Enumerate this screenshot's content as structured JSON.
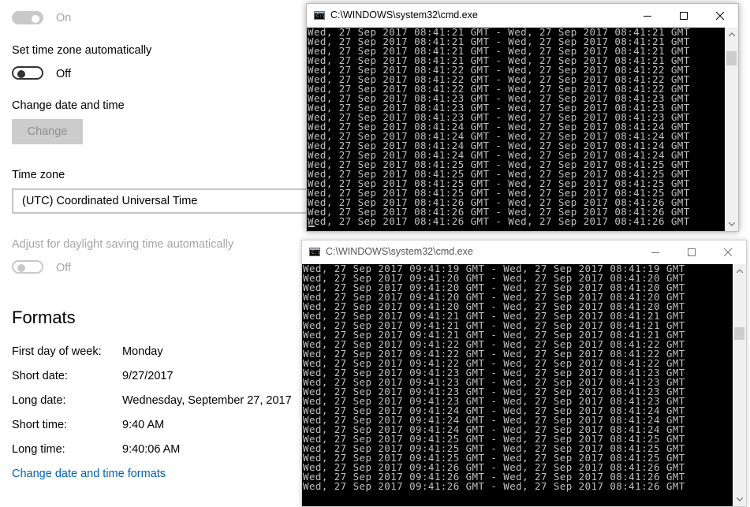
{
  "settings": {
    "top_toggle_state": "On",
    "set_tz_auto_label": "Set time zone automatically",
    "set_tz_auto_state": "Off",
    "change_dt_label": "Change date and time",
    "change_button": "Change",
    "time_zone_label": "Time zone",
    "time_zone_value": "(UTC) Coordinated Universal Time",
    "dst_label": "Adjust for daylight saving time automatically",
    "dst_state": "Off",
    "formats_heading": "Formats",
    "formats": [
      {
        "label": "First day of week:",
        "value": "Monday"
      },
      {
        "label": "Short date:",
        "value": "9/27/2017"
      },
      {
        "label": "Long date:",
        "value": "Wednesday, September 27, 2017"
      },
      {
        "label": "Short time:",
        "value": "9:40 AM"
      },
      {
        "label": "Long time:",
        "value": "9:40:06 AM"
      }
    ],
    "change_formats_link": "Change date and time formats"
  },
  "cmd_top": {
    "title": "C:\\WINDOWS\\system32\\cmd.exe",
    "icon_text": "C:\\",
    "lines": [
      "Wed, 27 Sep 2017 08:41:21 GMT - Wed, 27 Sep 2017 08:41:21 GMT",
      "Wed, 27 Sep 2017 08:41:21 GMT - Wed, 27 Sep 2017 08:41:21 GMT",
      "Wed, 27 Sep 2017 08:41:21 GMT - Wed, 27 Sep 2017 08:41:21 GMT",
      "Wed, 27 Sep 2017 08:41:21 GMT - Wed, 27 Sep 2017 08:41:21 GMT",
      "Wed, 27 Sep 2017 08:41:22 GMT - Wed, 27 Sep 2017 08:41:22 GMT",
      "Wed, 27 Sep 2017 08:41:22 GMT - Wed, 27 Sep 2017 08:41:22 GMT",
      "Wed, 27 Sep 2017 08:41:22 GMT - Wed, 27 Sep 2017 08:41:22 GMT",
      "Wed, 27 Sep 2017 08:41:23 GMT - Wed, 27 Sep 2017 08:41:23 GMT",
      "Wed, 27 Sep 2017 08:41:23 GMT - Wed, 27 Sep 2017 08:41:23 GMT",
      "Wed, 27 Sep 2017 08:41:23 GMT - Wed, 27 Sep 2017 08:41:23 GMT",
      "Wed, 27 Sep 2017 08:41:24 GMT - Wed, 27 Sep 2017 08:41:24 GMT",
      "Wed, 27 Sep 2017 08:41:24 GMT - Wed, 27 Sep 2017 08:41:24 GMT",
      "Wed, 27 Sep 2017 08:41:24 GMT - Wed, 27 Sep 2017 08:41:24 GMT",
      "Wed, 27 Sep 2017 08:41:24 GMT - Wed, 27 Sep 2017 08:41:24 GMT",
      "Wed, 27 Sep 2017 08:41:25 GMT - Wed, 27 Sep 2017 08:41:25 GMT",
      "Wed, 27 Sep 2017 08:41:25 GMT - Wed, 27 Sep 2017 08:41:25 GMT",
      "Wed, 27 Sep 2017 08:41:25 GMT - Wed, 27 Sep 2017 08:41:25 GMT",
      "Wed, 27 Sep 2017 08:41:25 GMT - Wed, 27 Sep 2017 08:41:25 GMT",
      "Wed, 27 Sep 2017 08:41:26 GMT - Wed, 27 Sep 2017 08:41:26 GMT",
      "Wed, 27 Sep 2017 08:41:26 GMT - Wed, 27 Sep 2017 08:41:26 GMT",
      "Wed, 27 Sep 2017 08:41:26 GMT - Wed, 27 Sep 2017 08:41:26 GMT"
    ]
  },
  "cmd_bottom": {
    "title": "C:\\WINDOWS\\system32\\cmd.exe",
    "icon_text": "C:\\",
    "lines": [
      "Wed, 27 Sep 2017 09:41:19 GMT - Wed, 27 Sep 2017 08:41:19 GMT",
      "Wed, 27 Sep 2017 09:41:20 GMT - Wed, 27 Sep 2017 08:41:20 GMT",
      "Wed, 27 Sep 2017 09:41:20 GMT - Wed, 27 Sep 2017 08:41:20 GMT",
      "Wed, 27 Sep 2017 09:41:20 GMT - Wed, 27 Sep 2017 08:41:20 GMT",
      "Wed, 27 Sep 2017 09:41:20 GMT - Wed, 27 Sep 2017 08:41:20 GMT",
      "Wed, 27 Sep 2017 09:41:21 GMT - Wed, 27 Sep 2017 08:41:21 GMT",
      "Wed, 27 Sep 2017 09:41:21 GMT - Wed, 27 Sep 2017 08:41:21 GMT",
      "Wed, 27 Sep 2017 09:41:21 GMT - Wed, 27 Sep 2017 08:41:21 GMT",
      "Wed, 27 Sep 2017 09:41:22 GMT - Wed, 27 Sep 2017 08:41:22 GMT",
      "Wed, 27 Sep 2017 09:41:22 GMT - Wed, 27 Sep 2017 08:41:22 GMT",
      "Wed, 27 Sep 2017 09:41:22 GMT - Wed, 27 Sep 2017 08:41:22 GMT",
      "Wed, 27 Sep 2017 09:41:23 GMT - Wed, 27 Sep 2017 08:41:23 GMT",
      "Wed, 27 Sep 2017 09:41:23 GMT - Wed, 27 Sep 2017 08:41:23 GMT",
      "Wed, 27 Sep 2017 09:41:23 GMT - Wed, 27 Sep 2017 08:41:23 GMT",
      "Wed, 27 Sep 2017 09:41:23 GMT - Wed, 27 Sep 2017 08:41:23 GMT",
      "Wed, 27 Sep 2017 09:41:24 GMT - Wed, 27 Sep 2017 08:41:24 GMT",
      "Wed, 27 Sep 2017 09:41:24 GMT - Wed, 27 Sep 2017 08:41:24 GMT",
      "Wed, 27 Sep 2017 09:41:24 GMT - Wed, 27 Sep 2017 08:41:24 GMT",
      "Wed, 27 Sep 2017 09:41:25 GMT - Wed, 27 Sep 2017 08:41:25 GMT",
      "Wed, 27 Sep 2017 09:41:25 GMT - Wed, 27 Sep 2017 08:41:25 GMT",
      "Wed, 27 Sep 2017 09:41:25 GMT - Wed, 27 Sep 2017 08:41:25 GMT",
      "Wed, 27 Sep 2017 09:41:26 GMT - Wed, 27 Sep 2017 08:41:26 GMT",
      "Wed, 27 Sep 2017 09:41:26 GMT - Wed, 27 Sep 2017 08:41:26 GMT",
      "Wed, 27 Sep 2017 09:41:26 GMT - Wed, 27 Sep 2017 08:41:26 GMT"
    ]
  },
  "colors": {
    "link": "#0063b1",
    "console_bg": "#000000",
    "console_text": "#c0c0c0",
    "close_hover": "#e81123"
  },
  "icons": [
    "minimize-icon",
    "maximize-icon",
    "close-icon",
    "scroll-up-icon",
    "scroll-down-icon",
    "cmd-app-icon"
  ]
}
